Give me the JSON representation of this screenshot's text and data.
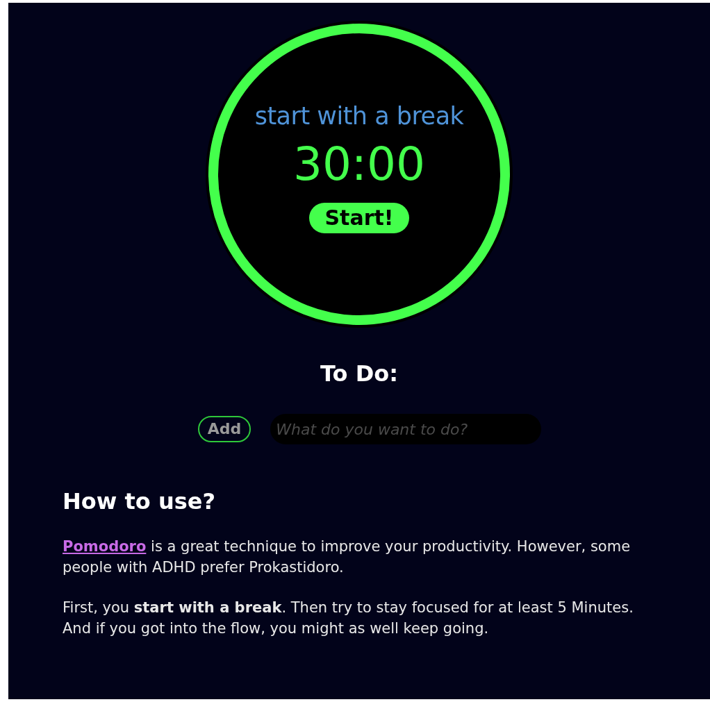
{
  "timer": {
    "mode_label": "start with a break",
    "time": "30:00",
    "start_button": "Start!"
  },
  "todo": {
    "heading": "To Do:",
    "add_button": "Add",
    "input": {
      "placeholder": "What do you want to do?"
    }
  },
  "help": {
    "heading": "How to use?",
    "paragraphs": [
      {
        "link": "Pomodoro",
        "text": " is a great technique to improve your productivity. However, some people with ADHD prefer Prokastidoro."
      },
      {
        "text": "First, you **start with a break**. Then try to stay focused for at least 5 Minutes. And if you got into the flow, you might as well keep going."
      }
    ]
  }
}
